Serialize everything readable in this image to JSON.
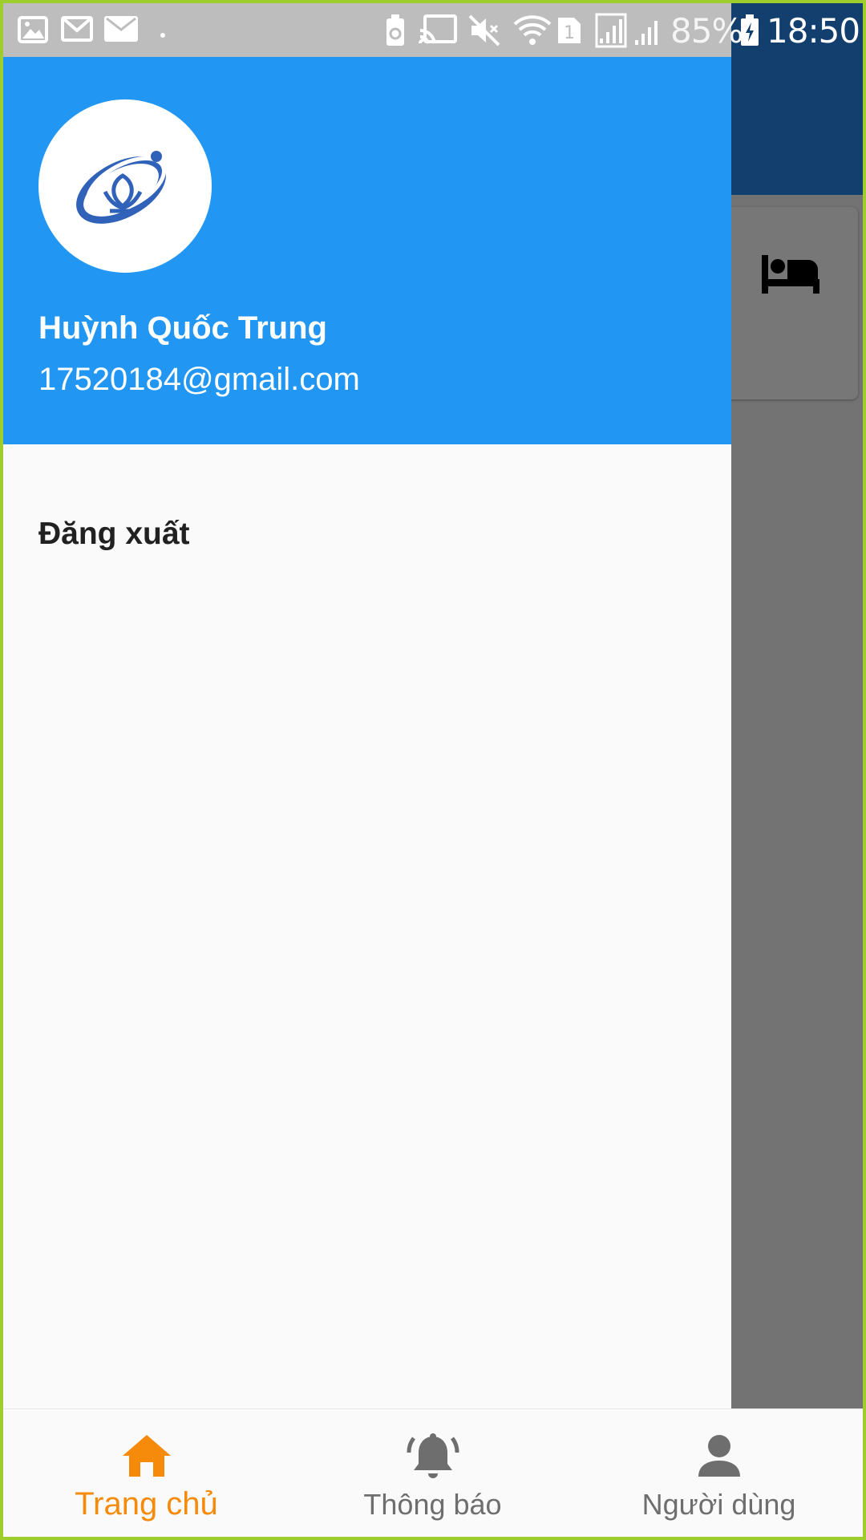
{
  "status_bar": {
    "battery_percent": "85%",
    "time": "18:50",
    "sim_slot": "1",
    "icons": [
      "gallery-icon",
      "gmail-icon",
      "mail-icon",
      "dot-icon",
      "battery-saver-icon",
      "cast-icon",
      "mute-icon",
      "wifi-icon",
      "sim-icon",
      "signal-icon",
      "signal-icon",
      "battery-charging-icon"
    ]
  },
  "drawer": {
    "user_name": "Huỳnh Quốc Trung",
    "user_email": "17520184@gmail.com",
    "logout_label": "Đăng xuất",
    "header_color": "#2196f3"
  },
  "background": {
    "card_icon": "bed-icon"
  },
  "bottom_nav": {
    "items": [
      {
        "label": "Trang chủ",
        "icon": "home-icon",
        "active": true
      },
      {
        "label": "Thông báo",
        "icon": "bell-icon",
        "active": false
      },
      {
        "label": "Người dùng",
        "icon": "person-icon",
        "active": false
      }
    ],
    "active_color": "#f58a0b",
    "inactive_color": "#6e6e6e"
  }
}
